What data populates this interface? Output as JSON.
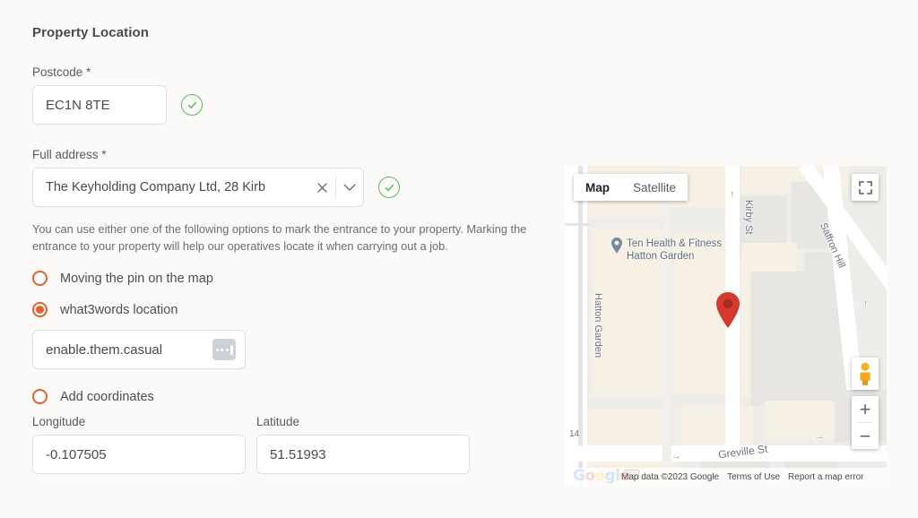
{
  "section": {
    "title": "Property Location"
  },
  "postcode": {
    "label": "Postcode *",
    "value": "EC1N 8TE",
    "valid_icon": "check-circle-icon",
    "valid_color": "#5cb85c"
  },
  "address": {
    "label": "Full address *",
    "value": "The Keyholding Company Ltd, 28 Kirb",
    "clear_icon": "close-icon",
    "caret_icon": "chevron-down-icon",
    "valid_icon": "check-circle-icon"
  },
  "helper_text": "You can use either one of the following options to mark the entrance to your property. Marking the entrance to your property will help our operatives locate it when carrying out a job.",
  "accent_color": "#e1622a",
  "options": [
    {
      "label": "Moving the pin on the map",
      "selected": false
    },
    {
      "label": "what3words location",
      "selected": true
    },
    {
      "label": "Add coordinates",
      "selected": false
    }
  ],
  "what3words": {
    "value": "enable.them.casual",
    "icon": "what3words-icon"
  },
  "coordinates": {
    "longitude_label": "Longitude",
    "longitude_value": "-0.107505",
    "latitude_label": "Latitude",
    "latitude_value": "51.51993"
  },
  "map": {
    "types": [
      {
        "label": "Map",
        "active": true
      },
      {
        "label": "Satellite",
        "active": false
      }
    ],
    "fullscreen_icon": "fullscreen-icon",
    "pegman_icon": "street-view-pegman-icon",
    "zoom_in": "+",
    "zoom_out": "−",
    "marker_icon": "map-marker-icon",
    "poi": {
      "line1": "Ten Health & Fitness",
      "line2": "Hatton Garden"
    },
    "street_labels": [
      "Hatton Garden",
      "Kirby St",
      "Saffron Hill",
      "Greville St"
    ],
    "building_number": "14",
    "attribution": {
      "brand": "Google",
      "keyboard_icon": "keyboard-icon",
      "data": "Map data ©2023 Google",
      "terms": "Terms of Use",
      "report": "Report a map error"
    }
  }
}
